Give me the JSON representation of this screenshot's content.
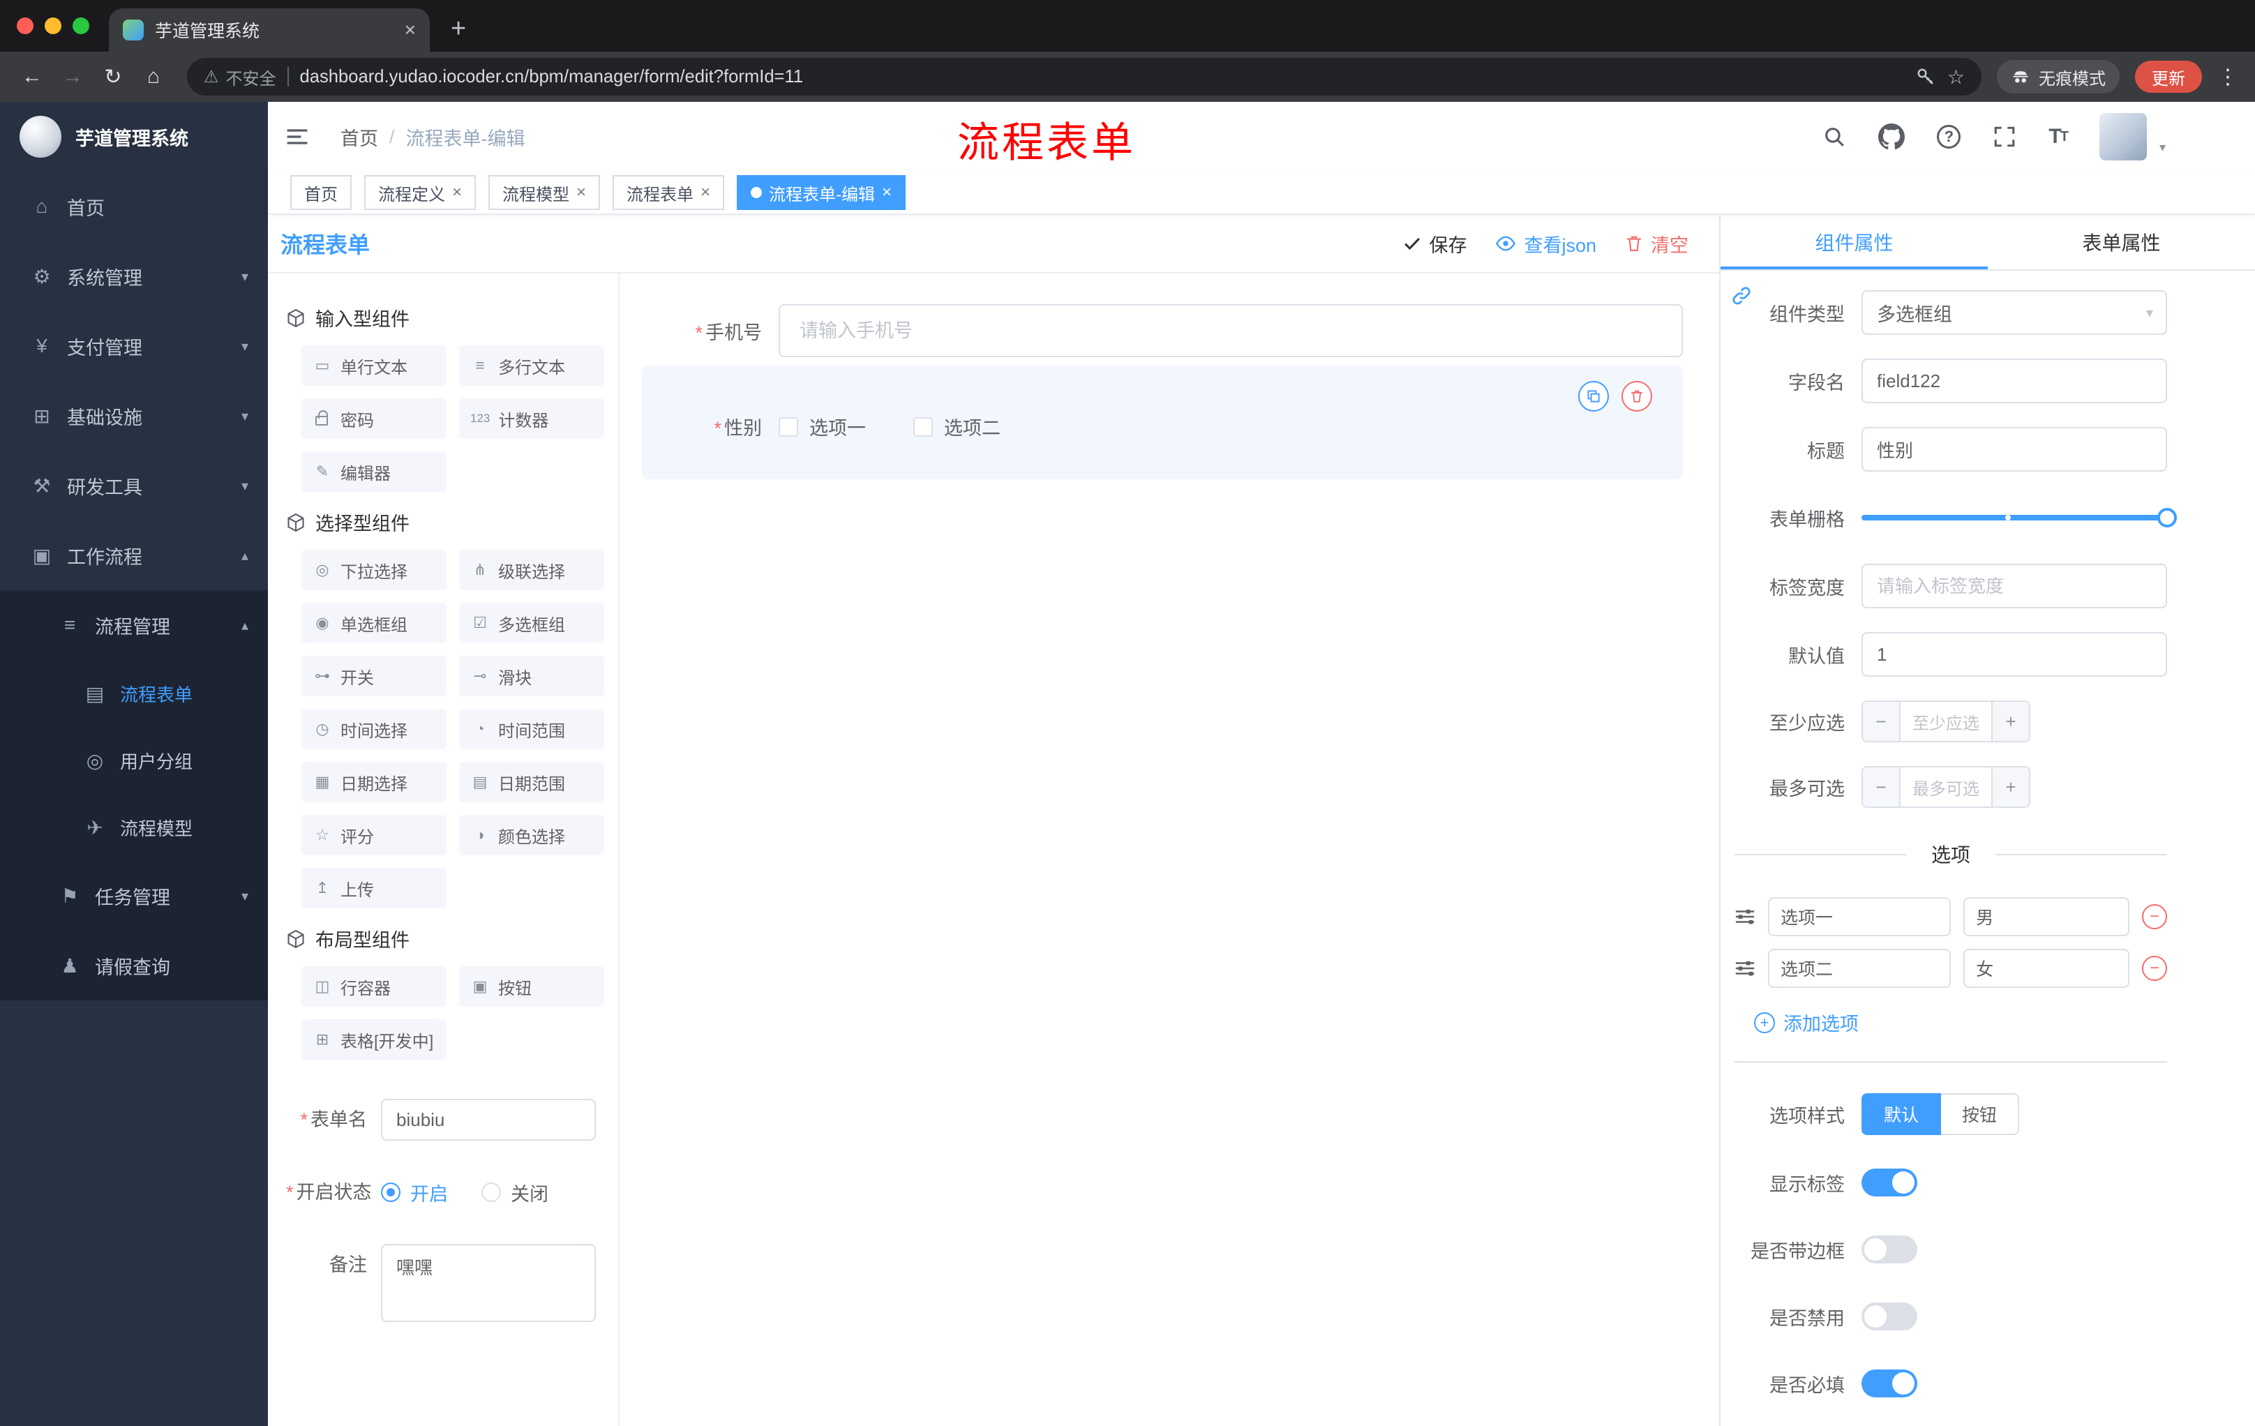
{
  "colors": {
    "accent": "#409eff",
    "danger": "#f56c6c",
    "annotation": "#ff0000",
    "update_pill": "#de5246",
    "sidebar_bg": "#273142"
  },
  "browser": {
    "tab_title": "芋道管理系统",
    "security_label": "不安全",
    "url": "dashboard.yudao.iocoder.cn/bpm/manager/form/edit?formId=11",
    "incognito_label": "无痕模式",
    "update_label": "更新"
  },
  "sidebar": {
    "logo_title": "芋道管理系统",
    "menu": [
      {
        "label": "首页",
        "glyph": "⌂"
      },
      {
        "label": "系统管理",
        "glyph": "⚙"
      },
      {
        "label": "支付管理",
        "glyph": "¥"
      },
      {
        "label": "基础设施",
        "glyph": "⊞"
      },
      {
        "label": "研发工具",
        "glyph": "⚒"
      },
      {
        "label": "工作流程",
        "glyph": "▣"
      }
    ],
    "submenu": [
      {
        "label": "流程管理",
        "glyph": "≡"
      },
      {
        "label": "流程表单",
        "glyph": "▤"
      },
      {
        "label": "用户分组",
        "glyph": "◎"
      },
      {
        "label": "流程模型",
        "glyph": "✈"
      },
      {
        "label": "任务管理",
        "glyph": "⚑"
      },
      {
        "label": "请假查询",
        "glyph": "♟"
      }
    ]
  },
  "header": {
    "breadcrumb": {
      "home": "首页",
      "separator": "/",
      "current": "流程表单-编辑"
    },
    "annotation": "流程表单"
  },
  "tags": [
    {
      "label": "首页"
    },
    {
      "label": "流程定义"
    },
    {
      "label": "流程模型"
    },
    {
      "label": "流程表单"
    },
    {
      "label": "流程表单-编辑"
    }
  ],
  "designer": {
    "title": "流程表单",
    "actions": {
      "save": "保存",
      "view_json": "查看json",
      "clear": "清空"
    },
    "palette": {
      "groups": [
        {
          "title": "输入型组件",
          "items": [
            {
              "label": "单行文本",
              "glyph": "▭"
            },
            {
              "label": "多行文本",
              "glyph": "≡"
            },
            {
              "label": "密码",
              "glyph": ""
            },
            {
              "label": "计数器",
              "glyph": "123"
            },
            {
              "label": "编辑器",
              "glyph": "✎"
            }
          ]
        },
        {
          "title": "选择型组件",
          "items": [
            {
              "label": "下拉选择",
              "glyph": "◎"
            },
            {
              "label": "级联选择",
              "glyph": "⋔"
            },
            {
              "label": "单选框组",
              "glyph": "◉"
            },
            {
              "label": "多选框组",
              "glyph": "☑"
            },
            {
              "label": "开关",
              "glyph": "⊶"
            },
            {
              "label": "滑块",
              "glyph": "⊸"
            },
            {
              "label": "时间选择",
              "glyph": "◷"
            },
            {
              "label": "时间范围",
              "glyph": "◔"
            },
            {
              "label": "日期选择",
              "glyph": "▦"
            },
            {
              "label": "日期范围",
              "glyph": "▤"
            },
            {
              "label": "评分",
              "glyph": "☆"
            },
            {
              "label": "颜色选择",
              "glyph": "◑"
            },
            {
              "label": "上传",
              "glyph": "↥"
            }
          ]
        },
        {
          "title": "布局型组件",
          "items": [
            {
              "label": "行容器",
              "glyph": "◫"
            },
            {
              "label": "按钮",
              "glyph": "▣"
            },
            {
              "label": "表格[开发中]",
              "glyph": "⊞"
            }
          ]
        }
      ]
    },
    "meta": {
      "name_label": "表单名",
      "name_value": "biubiu",
      "status_label": "开启状态",
      "status_on": "开启",
      "status_off": "关闭",
      "remark_label": "备注",
      "remark_value": "嘿嘿"
    }
  },
  "canvas": {
    "phone": {
      "label": "手机号",
      "placeholder": "请输入手机号"
    },
    "gender": {
      "label": "性别",
      "option1": "选项一",
      "option2": "选项二"
    }
  },
  "props": {
    "tab_component": "组件属性",
    "tab_form": "表单属性",
    "component_type": {
      "label": "组件类型",
      "value": "多选框组"
    },
    "field_name": {
      "label": "字段名",
      "value": "field122"
    },
    "title": {
      "label": "标题",
      "value": "性别"
    },
    "grid": {
      "label": "表单栅格"
    },
    "label_width": {
      "label": "标签宽度",
      "placeholder": "请输入标签宽度"
    },
    "default_value": {
      "label": "默认值",
      "value": "1"
    },
    "min_select": {
      "label": "至少应选",
      "placeholder": "至少应选"
    },
    "max_select": {
      "label": "最多可选",
      "placeholder": "最多可选"
    },
    "options_title": "选项",
    "options": [
      {
        "name": "选项一",
        "value": "男"
      },
      {
        "name": "选项二",
        "value": "女"
      }
    ],
    "add_option": "添加选项",
    "style": {
      "label": "选项样式",
      "default": "默认",
      "button": "按钮"
    },
    "switches": [
      {
        "label": "显示标签",
        "on": true
      },
      {
        "label": "是否带边框",
        "on": false
      },
      {
        "label": "是否禁用",
        "on": false
      },
      {
        "label": "是否必填",
        "on": true
      }
    ]
  }
}
